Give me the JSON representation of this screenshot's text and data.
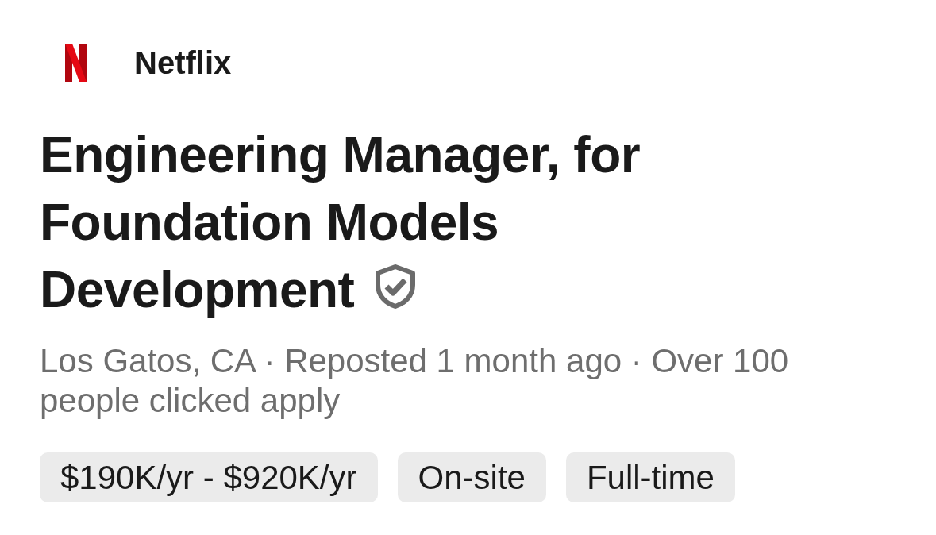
{
  "company": {
    "name": "Netflix"
  },
  "job": {
    "title": "Engineering Manager, for Foundation Models Development",
    "verified": true
  },
  "meta": "Los Gatos, CA · Reposted 1 month ago · Over 100 people clicked apply",
  "tags": [
    {
      "label": "$190K/yr - $920K/yr"
    },
    {
      "label": "On-site"
    },
    {
      "label": "Full-time"
    }
  ]
}
